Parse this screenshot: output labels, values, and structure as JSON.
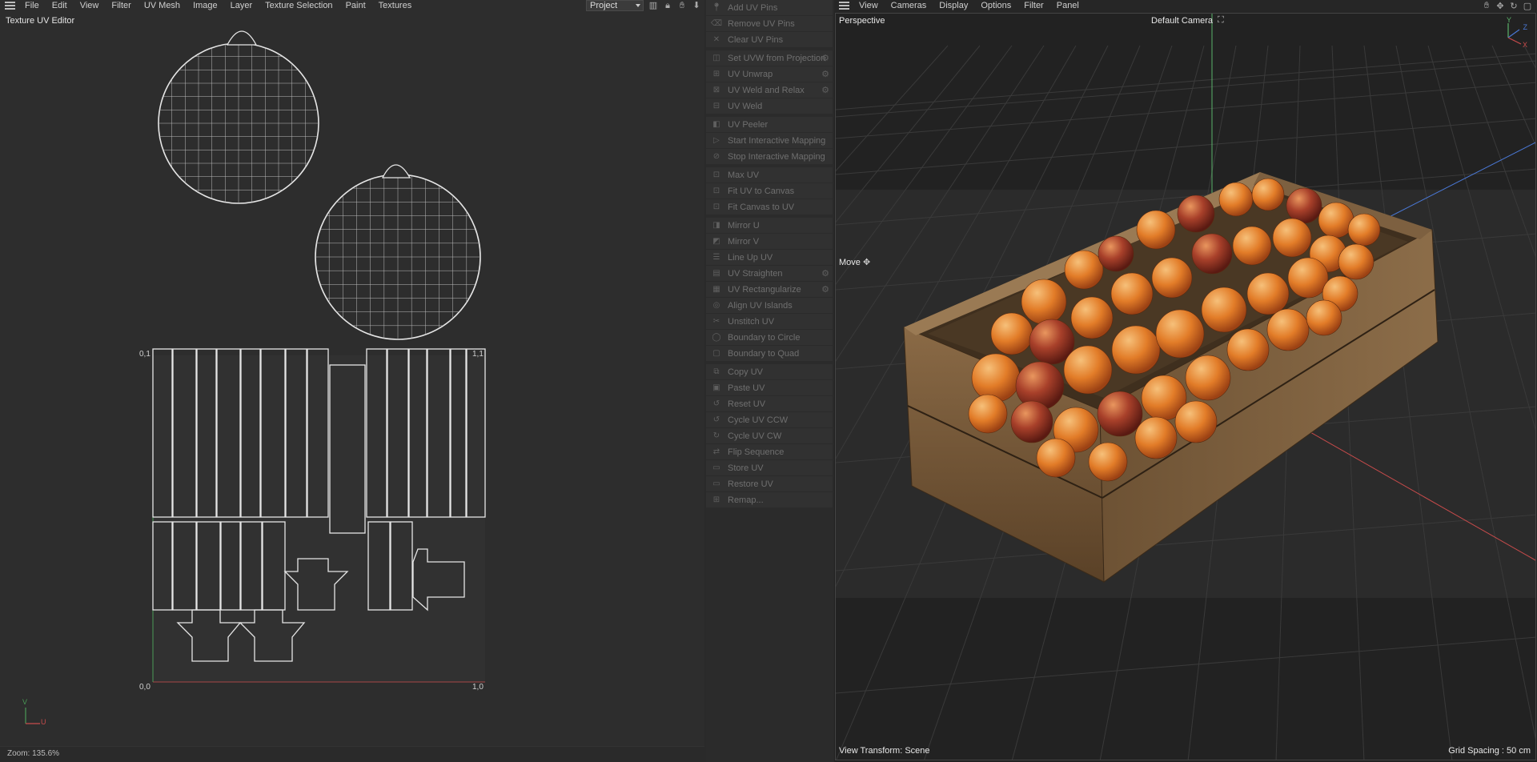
{
  "uv_editor": {
    "menu": [
      "File",
      "Edit",
      "View",
      "Filter",
      "UV Mesh",
      "Image",
      "Layer",
      "Texture Selection",
      "Paint",
      "Textures"
    ],
    "title": "Texture UV Editor",
    "project_select": "Project",
    "axis_labels": {
      "origin": "0,0",
      "u_max": "1,0",
      "v_max": "0,1",
      "uv_max": "1,1"
    },
    "gizmo": {
      "v": "V",
      "u": "U"
    },
    "zoom": "Zoom: 135.6%",
    "icons": [
      "histogram-icon",
      "lock-icon",
      "hand-icon",
      "download-icon"
    ]
  },
  "tool_panel": {
    "groups": [
      [
        {
          "label": "Add UV Pins",
          "icon": "pin-icon",
          "gear": false
        },
        {
          "label": "Remove UV Pins",
          "icon": "pin-remove-icon",
          "gear": false
        },
        {
          "label": "Clear UV Pins",
          "icon": "clear-icon",
          "gear": false
        }
      ],
      [
        {
          "label": "Set UVW from Projection",
          "icon": "projection-icon",
          "gear": true
        },
        {
          "label": "UV Unwrap",
          "icon": "unwrap-icon",
          "gear": true
        },
        {
          "label": "UV Weld and Relax",
          "icon": "weld-relax-icon",
          "gear": true
        },
        {
          "label": "UV Weld",
          "icon": "weld-icon",
          "gear": false
        }
      ],
      [
        {
          "label": "UV Peeler",
          "icon": "peeler-icon",
          "gear": false
        },
        {
          "label": "Start Interactive Mapping",
          "icon": "play-icon",
          "gear": false
        },
        {
          "label": "Stop Interactive Mapping",
          "icon": "stop-icon",
          "gear": false
        }
      ],
      [
        {
          "label": "Max UV",
          "icon": "max-icon",
          "gear": false
        },
        {
          "label": "Fit UV to Canvas",
          "icon": "fit-icon",
          "gear": false
        },
        {
          "label": "Fit Canvas to UV",
          "icon": "fit-canvas-icon",
          "gear": false
        }
      ],
      [
        {
          "label": "Mirror U",
          "icon": "mirror-u-icon",
          "gear": false
        },
        {
          "label": "Mirror V",
          "icon": "mirror-v-icon",
          "gear": false
        },
        {
          "label": "Line Up UV",
          "icon": "lineup-icon",
          "gear": false
        },
        {
          "label": "UV Straighten",
          "icon": "straighten-icon",
          "gear": true
        },
        {
          "label": "UV Rectangularize",
          "icon": "rectangularize-icon",
          "gear": true
        },
        {
          "label": "Align UV Islands",
          "icon": "align-icon",
          "gear": false
        },
        {
          "label": "Unstitch UV",
          "icon": "unstitch-icon",
          "gear": false
        },
        {
          "label": "Boundary to Circle",
          "icon": "circle-icon",
          "gear": false
        },
        {
          "label": "Boundary to Quad",
          "icon": "quad-icon",
          "gear": false
        }
      ],
      [
        {
          "label": "Copy UV",
          "icon": "copy-icon",
          "gear": false
        },
        {
          "label": "Paste UV",
          "icon": "paste-icon",
          "gear": false
        },
        {
          "label": "Reset UV",
          "icon": "reset-icon",
          "gear": false
        },
        {
          "label": "Cycle UV CCW",
          "icon": "ccw-icon",
          "gear": false
        },
        {
          "label": "Cycle UV CW",
          "icon": "cw-icon",
          "gear": false
        },
        {
          "label": "Flip Sequence",
          "icon": "flip-icon",
          "gear": false
        },
        {
          "label": "Store UV",
          "icon": "store-icon",
          "gear": false
        },
        {
          "label": "Restore UV",
          "icon": "restore-icon",
          "gear": false
        },
        {
          "label": "Remap...",
          "icon": "remap-icon",
          "gear": false
        }
      ]
    ]
  },
  "viewport": {
    "menu": [
      "View",
      "Cameras",
      "Display",
      "Options",
      "Filter",
      "Panel"
    ],
    "projection": "Perspective",
    "camera": "Default Camera",
    "tool": "Move",
    "view_transform": "View Transform: Scene",
    "grid_spacing": "Grid Spacing : 50 cm",
    "gizmo": {
      "y": "Y",
      "z": "Z",
      "x": "X"
    },
    "colors": {
      "x_axis": "#c84b4b",
      "y_axis": "#5bb36a",
      "z_axis": "#4a78d6",
      "wood": "#7a5c3a",
      "fruit": "#e0782a"
    }
  }
}
